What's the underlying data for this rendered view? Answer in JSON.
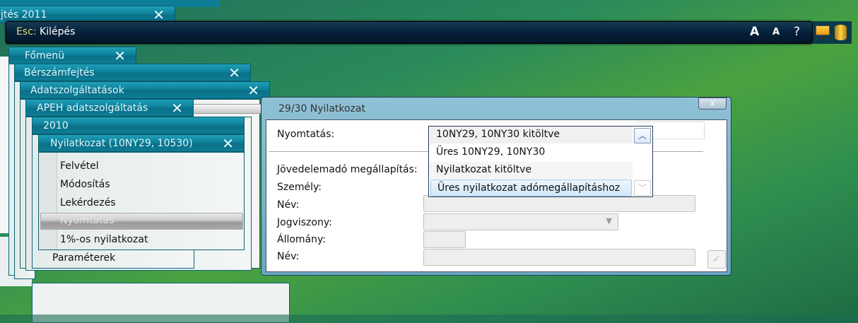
{
  "toolbar": {
    "esc_key": "Esc:",
    "esc_label": "Kilépés",
    "font_large": "A",
    "font_small": "A",
    "help": "?"
  },
  "windows": {
    "top": "jtés 2011",
    "fomenu": "Főmenü",
    "berszam": "Bérszámfejtés",
    "adatszolg": "Adatszolgáltatások",
    "apeh": "APEH adatszolgáltatás",
    "year": "2010",
    "nyilatkozat": "Nyilatkozat (10NY29, 10530)",
    "close": "✕"
  },
  "menu": {
    "items": [
      "Felvétel",
      "Módosítás",
      "Lekérdezés",
      "Nyomtatás",
      "1%-os nyilatkozat"
    ],
    "selected": 3,
    "behind_item": "Paraméterek"
  },
  "dialog": {
    "title": "29/30 Nyilatkozat",
    "close": "x",
    "labels": {
      "print": "Nyomtatás:",
      "tax": "Jövedelemadó megállapítás:",
      "person": "Személy:",
      "name": "Név:",
      "relation": "Jogviszony:",
      "staff": "Állomány:",
      "name2": "Név:"
    },
    "dropdown": {
      "selected": "10NY29, 10NY30 kitöltve",
      "options": [
        "Üres 10NY29, 10NY30",
        "Nyilatkozat kitöltve",
        "Üres nyilatkozat adómegállapításhoz"
      ],
      "hovered": 2
    }
  }
}
